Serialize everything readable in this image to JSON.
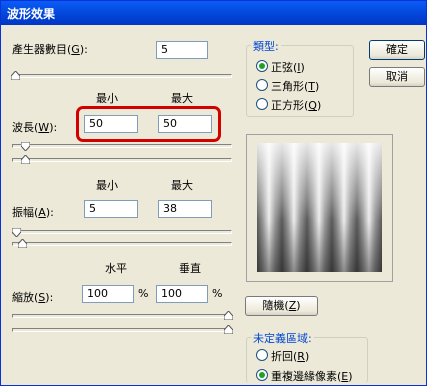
{
  "window": {
    "title": "波形效果"
  },
  "generators": {
    "label_prefix": "產生器數目(",
    "label_key": "G",
    "label_suffix": "):",
    "value": "5"
  },
  "wavelength": {
    "label_prefix": "波長(",
    "label_key": "W",
    "label_suffix": "):",
    "min_header": "最小",
    "max_header": "最大",
    "min_value": "50",
    "max_value": "50"
  },
  "amplitude": {
    "label_prefix": "振幅(",
    "label_key": "A",
    "label_suffix": "):",
    "min_header": "最小",
    "max_header": "最大",
    "min_value": "5",
    "max_value": "38"
  },
  "scale": {
    "label_prefix": "縮放(",
    "label_key": "S",
    "label_suffix": "):",
    "h_header": "水平",
    "v_header": "垂直",
    "h_value": "100",
    "v_value": "100",
    "unit": "%"
  },
  "type_group": {
    "title_prefix": "類型",
    "title_suffix": ":",
    "options": [
      {
        "label": "正弦(",
        "key": "I",
        "suffix": ")",
        "selected": true
      },
      {
        "label": "三角形(",
        "key": "T",
        "suffix": ")",
        "selected": false
      },
      {
        "label": "正方形(",
        "key": "Q",
        "suffix": ")",
        "selected": false
      }
    ]
  },
  "buttons": {
    "ok": "確定",
    "cancel": "取消",
    "randomize_prefix": "隨機(",
    "randomize_key": "Z",
    "randomize_suffix": ")"
  },
  "undefined_group": {
    "title": "未定義區域:",
    "options": [
      {
        "label": "折回(",
        "key": "R",
        "suffix": ")",
        "selected": false
      },
      {
        "label": "重複邊緣像素(",
        "key": "E",
        "suffix": ")",
        "selected": true
      }
    ]
  }
}
